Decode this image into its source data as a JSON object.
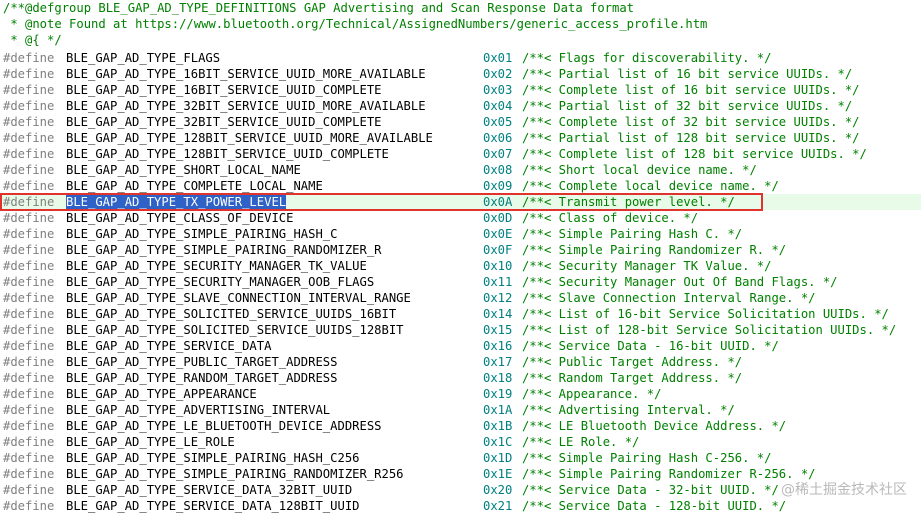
{
  "header": [
    "/**@defgroup BLE_GAP_AD_TYPE_DEFINITIONS GAP Advertising and Scan Response Data format",
    " * @note Found at https://www.bluetooth.org/Technical/AssignedNumbers/generic_access_profile.htm",
    " * @{ */"
  ],
  "define_keyword": "#define",
  "selected_index": 9,
  "defines": [
    {
      "name": "BLE_GAP_AD_TYPE_FLAGS",
      "value": "0x01",
      "comment": "/**< Flags for discoverability. */"
    },
    {
      "name": "BLE_GAP_AD_TYPE_16BIT_SERVICE_UUID_MORE_AVAILABLE",
      "value": "0x02",
      "comment": "/**< Partial list of 16 bit service UUIDs. */"
    },
    {
      "name": "BLE_GAP_AD_TYPE_16BIT_SERVICE_UUID_COMPLETE",
      "value": "0x03",
      "comment": "/**< Complete list of 16 bit service UUIDs. */"
    },
    {
      "name": "BLE_GAP_AD_TYPE_32BIT_SERVICE_UUID_MORE_AVAILABLE",
      "value": "0x04",
      "comment": "/**< Partial list of 32 bit service UUIDs. */"
    },
    {
      "name": "BLE_GAP_AD_TYPE_32BIT_SERVICE_UUID_COMPLETE",
      "value": "0x05",
      "comment": "/**< Complete list of 32 bit service UUIDs. */"
    },
    {
      "name": "BLE_GAP_AD_TYPE_128BIT_SERVICE_UUID_MORE_AVAILABLE",
      "value": "0x06",
      "comment": "/**< Partial list of 128 bit service UUIDs. */"
    },
    {
      "name": "BLE_GAP_AD_TYPE_128BIT_SERVICE_UUID_COMPLETE",
      "value": "0x07",
      "comment": "/**< Complete list of 128 bit service UUIDs. */"
    },
    {
      "name": "BLE_GAP_AD_TYPE_SHORT_LOCAL_NAME",
      "value": "0x08",
      "comment": "/**< Short local device name. */"
    },
    {
      "name": "BLE_GAP_AD_TYPE_COMPLETE_LOCAL_NAME",
      "value": "0x09",
      "comment": "/**< Complete local device name. */"
    },
    {
      "name": "BLE_GAP_AD_TYPE_TX_POWER_LEVEL",
      "value": "0x0A",
      "comment": "/**< Transmit power level. */"
    },
    {
      "name": "BLE_GAP_AD_TYPE_CLASS_OF_DEVICE",
      "value": "0x0D",
      "comment": "/**< Class of device. */"
    },
    {
      "name": "BLE_GAP_AD_TYPE_SIMPLE_PAIRING_HASH_C",
      "value": "0x0E",
      "comment": "/**< Simple Pairing Hash C. */"
    },
    {
      "name": "BLE_GAP_AD_TYPE_SIMPLE_PAIRING_RANDOMIZER_R",
      "value": "0x0F",
      "comment": "/**< Simple Pairing Randomizer R. */"
    },
    {
      "name": "BLE_GAP_AD_TYPE_SECURITY_MANAGER_TK_VALUE",
      "value": "0x10",
      "comment": "/**< Security Manager TK Value. */"
    },
    {
      "name": "BLE_GAP_AD_TYPE_SECURITY_MANAGER_OOB_FLAGS",
      "value": "0x11",
      "comment": "/**< Security Manager Out Of Band Flags. */"
    },
    {
      "name": "BLE_GAP_AD_TYPE_SLAVE_CONNECTION_INTERVAL_RANGE",
      "value": "0x12",
      "comment": "/**< Slave Connection Interval Range. */"
    },
    {
      "name": "BLE_GAP_AD_TYPE_SOLICITED_SERVICE_UUIDS_16BIT",
      "value": "0x14",
      "comment": "/**< List of 16-bit Service Solicitation UUIDs. */"
    },
    {
      "name": "BLE_GAP_AD_TYPE_SOLICITED_SERVICE_UUIDS_128BIT",
      "value": "0x15",
      "comment": "/**< List of 128-bit Service Solicitation UUIDs. */"
    },
    {
      "name": "BLE_GAP_AD_TYPE_SERVICE_DATA",
      "value": "0x16",
      "comment": "/**< Service Data - 16-bit UUID. */"
    },
    {
      "name": "BLE_GAP_AD_TYPE_PUBLIC_TARGET_ADDRESS",
      "value": "0x17",
      "comment": "/**< Public Target Address. */"
    },
    {
      "name": "BLE_GAP_AD_TYPE_RANDOM_TARGET_ADDRESS",
      "value": "0x18",
      "comment": "/**< Random Target Address. */"
    },
    {
      "name": "BLE_GAP_AD_TYPE_APPEARANCE",
      "value": "0x19",
      "comment": "/**< Appearance. */"
    },
    {
      "name": "BLE_GAP_AD_TYPE_ADVERTISING_INTERVAL",
      "value": "0x1A",
      "comment": "/**< Advertising Interval. */"
    },
    {
      "name": "BLE_GAP_AD_TYPE_LE_BLUETOOTH_DEVICE_ADDRESS",
      "value": "0x1B",
      "comment": "/**< LE Bluetooth Device Address. */"
    },
    {
      "name": "BLE_GAP_AD_TYPE_LE_ROLE",
      "value": "0x1C",
      "comment": "/**< LE Role. */"
    },
    {
      "name": "BLE_GAP_AD_TYPE_SIMPLE_PAIRING_HASH_C256",
      "value": "0x1D",
      "comment": "/**< Simple Pairing Hash C-256. */"
    },
    {
      "name": "BLE_GAP_AD_TYPE_SIMPLE_PAIRING_RANDOMIZER_R256",
      "value": "0x1E",
      "comment": "/**< Simple Pairing Randomizer R-256. */"
    },
    {
      "name": "BLE_GAP_AD_TYPE_SERVICE_DATA_32BIT_UUID",
      "value": "0x20",
      "comment": "/**< Service Data - 32-bit UUID. */"
    },
    {
      "name": "BLE_GAP_AD_TYPE_SERVICE_DATA_128BIT_UUID",
      "value": "0x21",
      "comment": "/**< Service Data - 128-bit UUID. */"
    }
  ],
  "watermark": "@稀土掘金技术社区"
}
